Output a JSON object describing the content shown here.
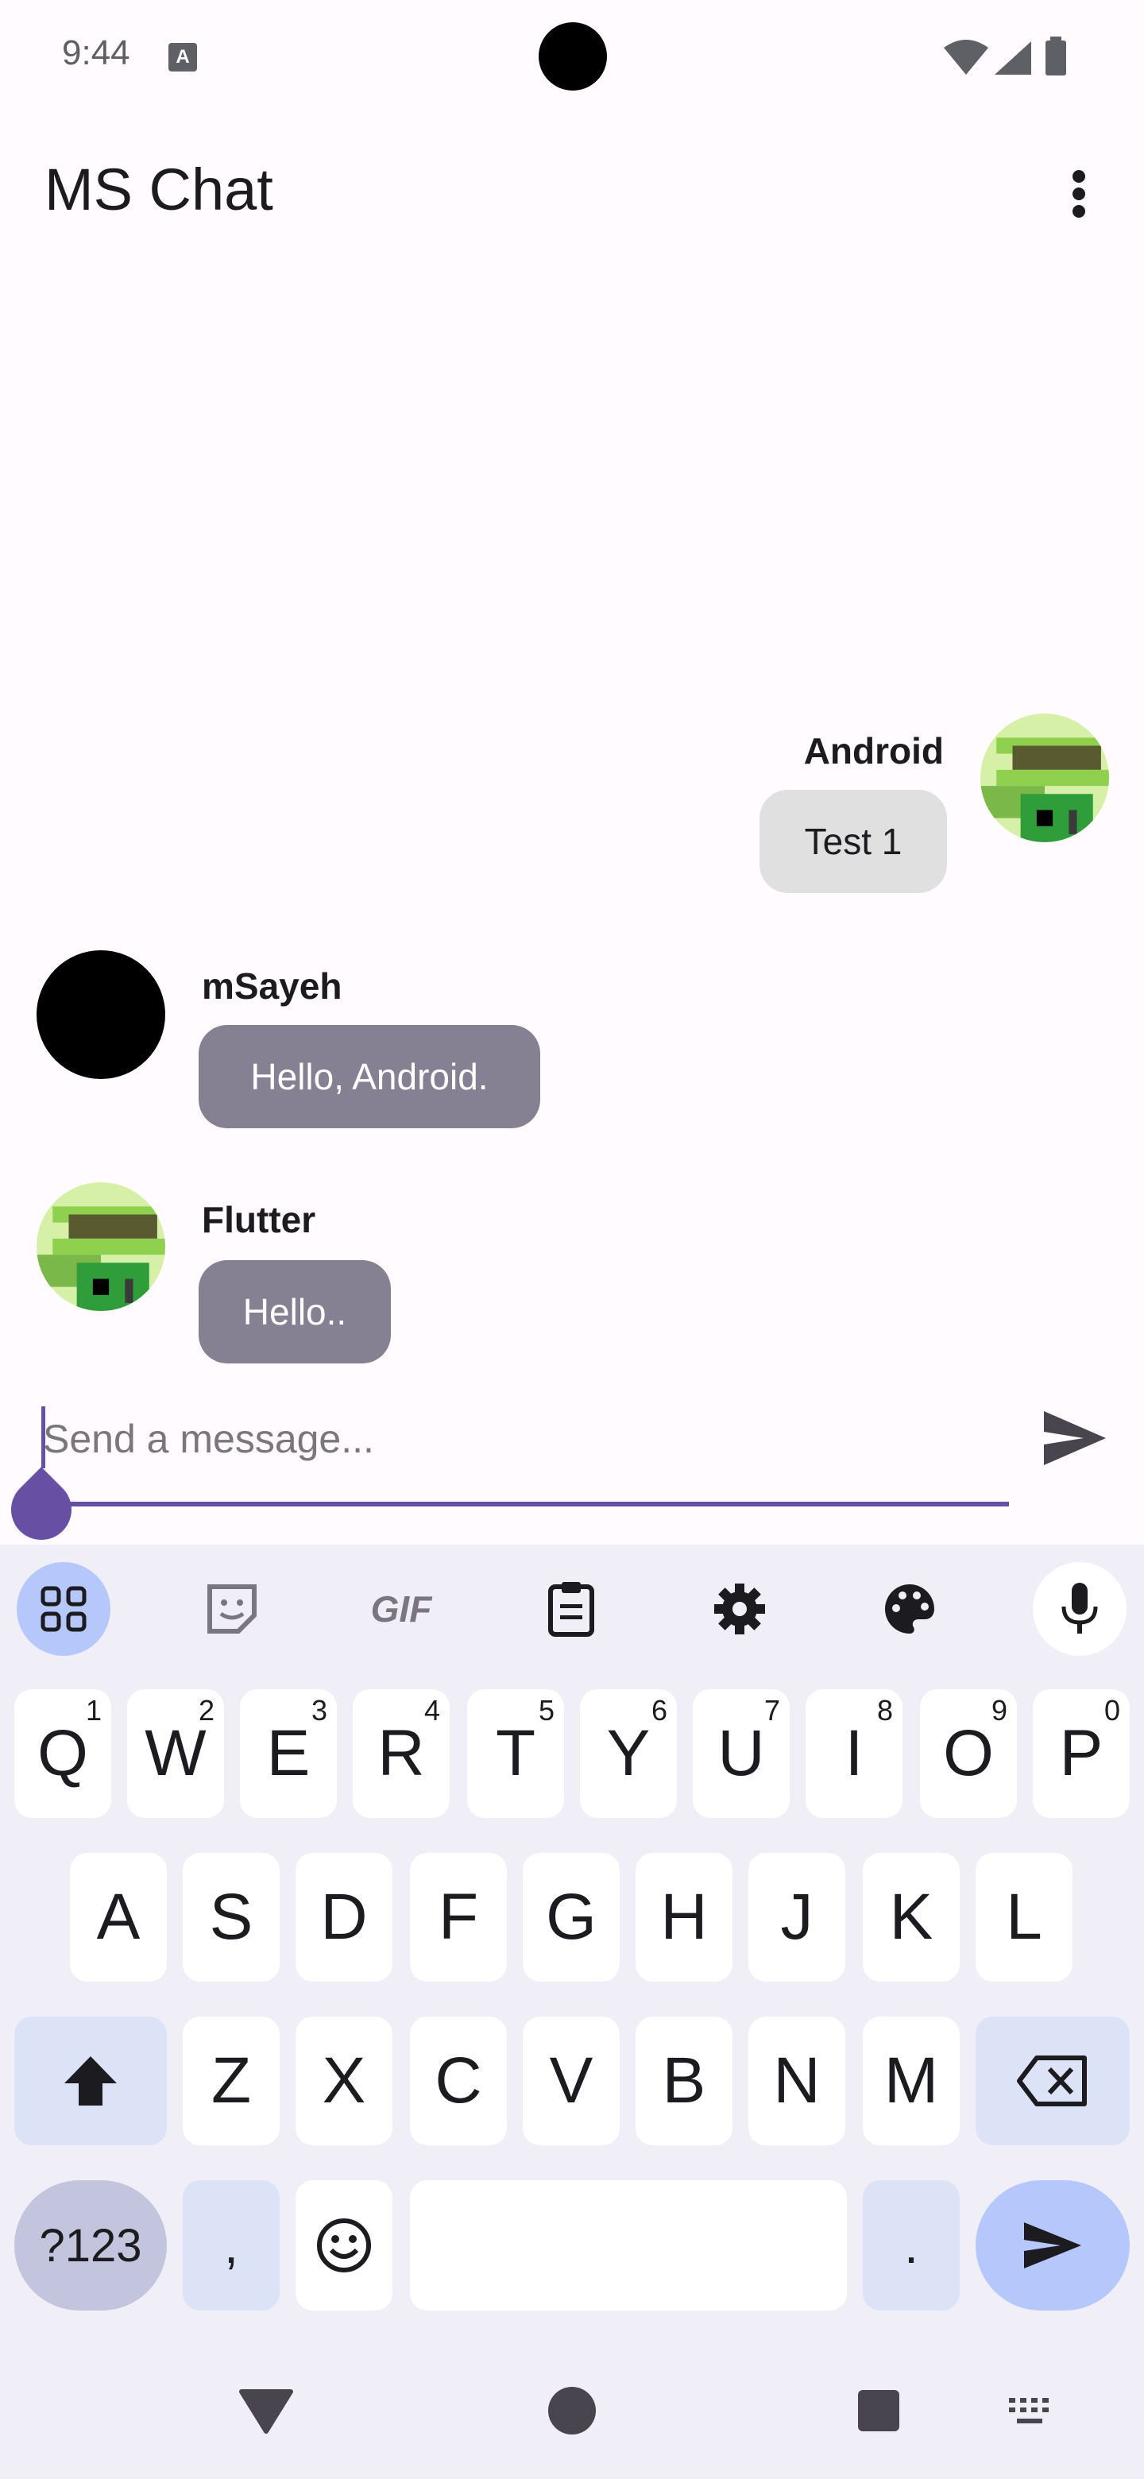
{
  "status_bar": {
    "time": "9:44",
    "notification_icon": "text-icon",
    "icons": [
      "wifi-icon",
      "signal-icon",
      "battery-icon"
    ]
  },
  "app_bar": {
    "title": "MS Chat",
    "menu_icon": "more-vert-icon"
  },
  "messages": [
    {
      "sender": "Android",
      "text": "Test 1",
      "side": "right"
    },
    {
      "sender": "mSayeh",
      "text": "Hello, Android.",
      "side": "left"
    },
    {
      "sender": "Flutter",
      "text": "Hello..",
      "side": "left"
    }
  ],
  "composer": {
    "placeholder": "Send a message...",
    "send_icon": "send-icon"
  },
  "keyboard": {
    "toolbar": [
      "apps-grid-icon",
      "sticker-icon",
      "GIF",
      "clipboard-icon",
      "settings-icon",
      "palette-icon",
      "mic-icon"
    ],
    "row1": [
      {
        "k": "Q",
        "h": "1"
      },
      {
        "k": "W",
        "h": "2"
      },
      {
        "k": "E",
        "h": "3"
      },
      {
        "k": "R",
        "h": "4"
      },
      {
        "k": "T",
        "h": "5"
      },
      {
        "k": "Y",
        "h": "6"
      },
      {
        "k": "U",
        "h": "7"
      },
      {
        "k": "I",
        "h": "8"
      },
      {
        "k": "O",
        "h": "9"
      },
      {
        "k": "P",
        "h": "0"
      }
    ],
    "row2": [
      "A",
      "S",
      "D",
      "F",
      "G",
      "H",
      "J",
      "K",
      "L"
    ],
    "row3": [
      "Z",
      "X",
      "C",
      "V",
      "B",
      "N",
      "M"
    ],
    "symbols_label": "?123",
    "comma": ",",
    "period": "."
  },
  "colors": {
    "accent": "#6750a4",
    "other_bubble": "#858092",
    "my_bubble": "#e0e0e0"
  }
}
